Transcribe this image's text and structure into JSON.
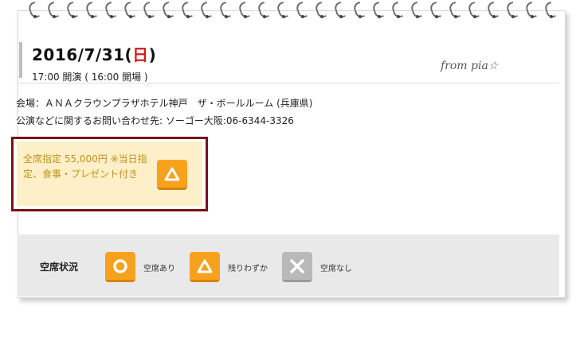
{
  "event": {
    "date_main": "2016/7/31(",
    "day_of_week": "日",
    "date_close": ")",
    "times": "17:00 開演 ( 16:00 開場 )",
    "source_signature": "from pia☆"
  },
  "details": {
    "venue": "会場：ＡＮＡクラウンプラザホテル神戸　ザ・ボールルーム (兵庫県)",
    "contact": "公演などに関するお問い合わせ先: ソーゴー大阪:06-6344-3326"
  },
  "ticket": {
    "description": "全席指定 55,000円 ※当日指定、食事・プレゼント付き",
    "status_icon": "triangle-icon"
  },
  "legend": {
    "title": "空席状況",
    "items": [
      {
        "icon": "circle-icon",
        "label": "空席あり"
      },
      {
        "icon": "triangle-icon",
        "label": "残りわずか"
      },
      {
        "icon": "cross-icon",
        "label": "空席なし"
      }
    ]
  },
  "colors": {
    "accent_orange": "#f7a21c",
    "sunday_red": "#d6191f",
    "ticket_border": "#7a1018",
    "ticket_bg": "#fdf0c8",
    "ticket_text": "#c4901b",
    "unavailable_gray": "#b9b9b9"
  }
}
